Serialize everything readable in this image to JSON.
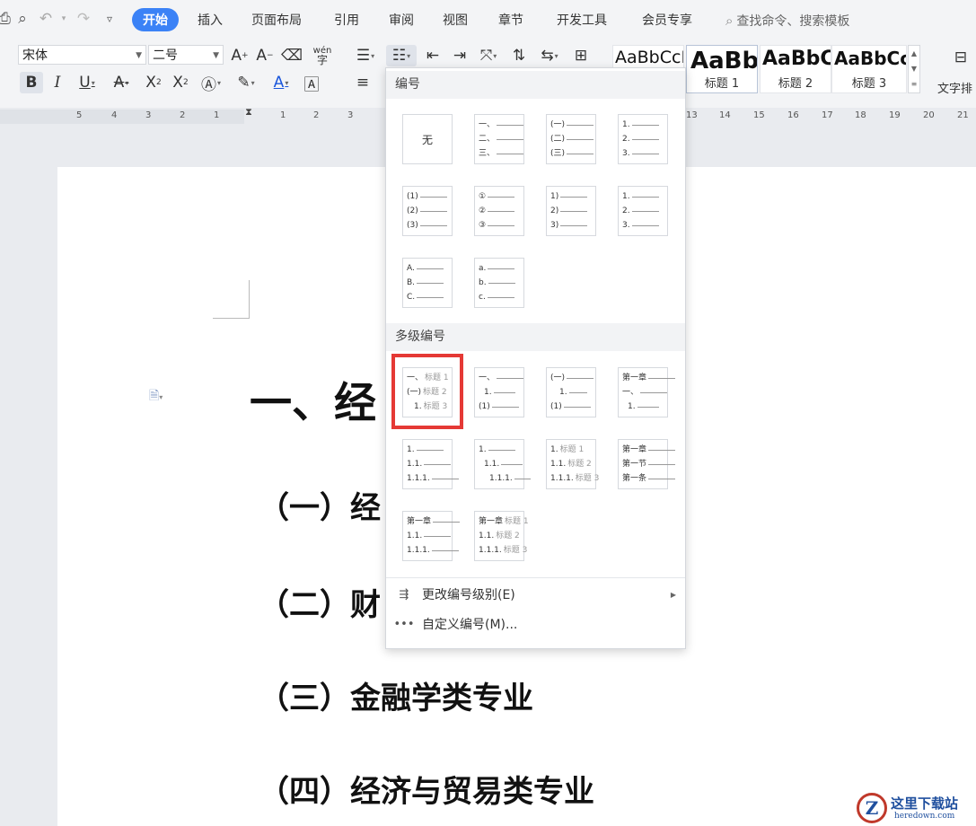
{
  "menubar": {
    "tabs": [
      "开始",
      "插入",
      "页面布局",
      "引用",
      "审阅",
      "视图",
      "章节",
      "开发工具",
      "会员专享"
    ],
    "search_placeholder": "查找命令、搜索模板"
  },
  "ribbon": {
    "font_name": "宋体",
    "font_size": "二号",
    "phonetic_label": "wén",
    "styles": [
      {
        "sample": "AaBbCcDd",
        "name": ""
      },
      {
        "sample": "AaBb",
        "name": "标题 1"
      },
      {
        "sample": "AaBbC",
        "name": "标题 2"
      },
      {
        "sample": "AaBbCcD",
        "name": "标题 3"
      }
    ],
    "text_layout_label": "文字排"
  },
  "ruler": {
    "left_numbers": [
      "5",
      "4",
      "3",
      "2",
      "1"
    ],
    "mid_numbers": [
      "1",
      "2",
      "3"
    ],
    "right_numbers": [
      "13",
      "14",
      "15",
      "16",
      "17",
      "18",
      "19",
      "20",
      "21"
    ]
  },
  "document": {
    "heading1": "一、经",
    "sub1": "（一）经",
    "sub2": "（二）财",
    "sub3": "（三）金融学类专业",
    "sub4": "（四）经济与贸易类专业"
  },
  "dropdown": {
    "section_numbering": "编号",
    "none_label": "无",
    "section_multilevel": "多级编号",
    "single_tiles": [
      [
        "一、",
        "二、",
        "三、"
      ],
      [
        "(一)",
        "(二)",
        "(三)"
      ],
      [
        "1.",
        "2.",
        "3."
      ],
      [
        "(1)",
        "(2)",
        "(3)"
      ],
      [
        "①",
        "②",
        "③"
      ],
      [
        "1)",
        "2)",
        "3)"
      ],
      [
        "1.",
        "2.",
        "3."
      ],
      [
        "A.",
        "B.",
        "C."
      ],
      [
        "a.",
        "b.",
        "c."
      ]
    ],
    "multi_tiles": [
      [
        {
          "p": "一、",
          "t": "标题 1"
        },
        {
          "p": "(一)",
          "t": "标题 2"
        },
        {
          "p": "1.",
          "t": "标题 3"
        }
      ],
      [
        {
          "p": "一、",
          "t": ""
        },
        {
          "p": "1.",
          "t": ""
        },
        {
          "p": "(1)",
          "t": ""
        }
      ],
      [
        {
          "p": "(一)",
          "t": ""
        },
        {
          "p": "1.",
          "t": ""
        },
        {
          "p": "(1)",
          "t": ""
        }
      ],
      [
        {
          "p": "第一章",
          "t": ""
        },
        {
          "p": "一、",
          "t": ""
        },
        {
          "p": "1.",
          "t": ""
        }
      ],
      [
        {
          "p": "1.",
          "t": ""
        },
        {
          "p": "1.1.",
          "t": ""
        },
        {
          "p": "1.1.1.",
          "t": ""
        }
      ],
      [
        {
          "p": "1.",
          "t": ""
        },
        {
          "p": "1.1.",
          "t": ""
        },
        {
          "p": "1.1.1.",
          "t": ""
        }
      ],
      [
        {
          "p": "1.",
          "t": "标题 1"
        },
        {
          "p": "1.1.",
          "t": "标题 2"
        },
        {
          "p": "1.1.1.",
          "t": "标题 3"
        }
      ],
      [
        {
          "p": "第一章",
          "t": ""
        },
        {
          "p": "第一节",
          "t": ""
        },
        {
          "p": "第一条",
          "t": ""
        }
      ],
      [
        {
          "p": "第一章",
          "t": ""
        },
        {
          "p": "1.1.",
          "t": ""
        },
        {
          "p": "1.1.1.",
          "t": ""
        }
      ],
      [
        {
          "p": "第一章",
          "t": "标题 1"
        },
        {
          "p": "1.1.",
          "t": "标题 2"
        },
        {
          "p": "1.1.1.",
          "t": "标题 3"
        }
      ]
    ],
    "menu_change_level": "更改编号级别(E)",
    "menu_custom": "自定义编号(M)...",
    "highlight_color": "#e53935"
  },
  "watermark": {
    "cn": "这里下载站",
    "en": "heredown.com"
  }
}
